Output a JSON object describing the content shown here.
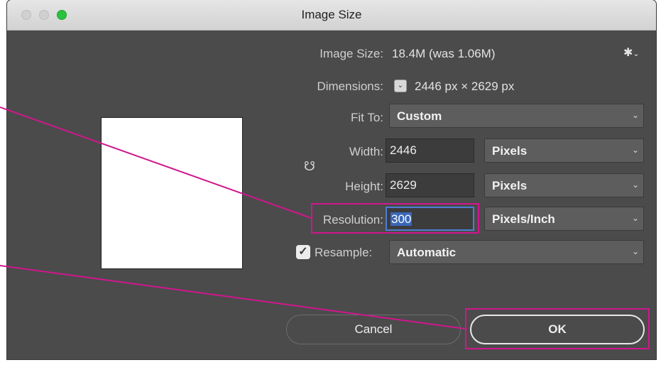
{
  "window": {
    "title": "Image Size"
  },
  "image_size": {
    "label": "Image Size:",
    "value": "18.4M (was 1.06M)"
  },
  "dimensions": {
    "label": "Dimensions:",
    "value": "2446 px  ×  2629 px"
  },
  "fit_to": {
    "label": "Fit To:",
    "value": "Custom"
  },
  "width": {
    "label": "Width:",
    "value": "2446",
    "unit": "Pixels"
  },
  "height": {
    "label": "Height:",
    "value": "2629",
    "unit": "Pixels"
  },
  "resolution": {
    "label": "Resolution:",
    "value": "300",
    "unit": "Pixels/Inch"
  },
  "resample": {
    "label": "Resample:",
    "value": "Automatic",
    "checked": true
  },
  "buttons": {
    "cancel": "Cancel",
    "ok": "OK"
  },
  "icons": {
    "settings": "gear-icon",
    "link": "link-icon",
    "chevron": "chevron-down-icon"
  },
  "colors": {
    "annotation": "#d1168d",
    "dialog_bg": "#4b4b4b",
    "selection": "#3a67b8",
    "zoom_button": "#29c33d"
  }
}
